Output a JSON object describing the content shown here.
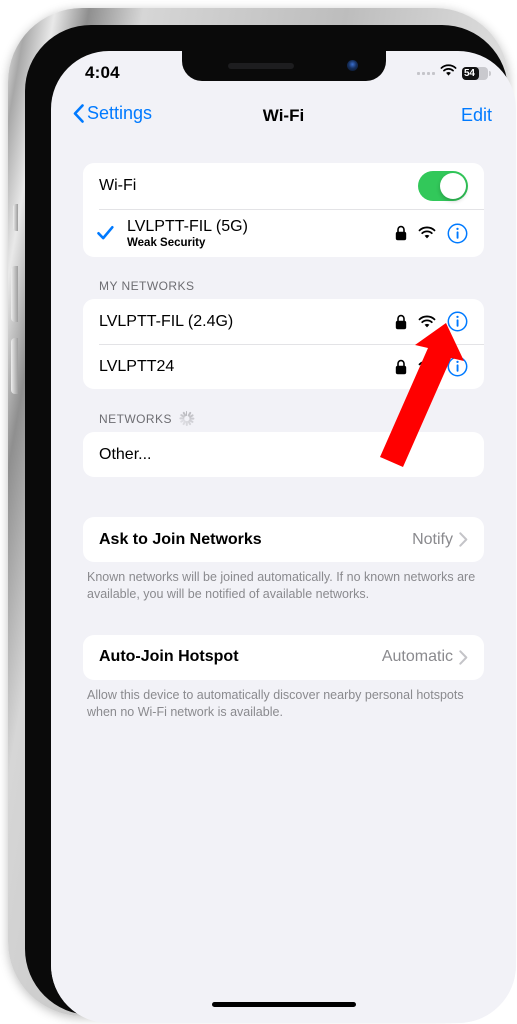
{
  "status_bar": {
    "time": "4:04",
    "battery_percent": "54",
    "wifi_icon": "wifi-icon",
    "signal_icon": "cellular-dots-icon"
  },
  "nav": {
    "back_label": "Settings",
    "title": "Wi-Fi",
    "edit_label": "Edit"
  },
  "wifi_toggle": {
    "label": "Wi-Fi",
    "state": "on",
    "color": "#32C85A"
  },
  "connected_network": {
    "name": "LVLPTT-FIL (5G)",
    "subtitle": "Weak Security",
    "checked": true,
    "locked": true
  },
  "my_networks": {
    "header": "MY NETWORKS",
    "items": [
      {
        "name": "LVLPTT-FIL (2.4G)",
        "locked": true
      },
      {
        "name": "LVLPTT24",
        "locked": true
      }
    ]
  },
  "networks": {
    "header": "NETWORKS",
    "scanning": true,
    "other_label": "Other..."
  },
  "ask_to_join": {
    "label": "Ask to Join Networks",
    "value": "Notify",
    "footnote": "Known networks will be joined automatically. If no known networks are available, you will be notified of available networks."
  },
  "auto_join_hotspot": {
    "label": "Auto-Join Hotspot",
    "value": "Automatic",
    "footnote": "Allow this device to automatically discover nearby personal hotspots when no Wi-Fi network is available."
  },
  "annotation": {
    "type": "arrow",
    "color": "#FF0000",
    "points_to": "wifi-toggle"
  },
  "colors": {
    "accent_blue": "#007AFF",
    "toggle_green": "#32C85A",
    "background": "#F2F2F7"
  }
}
